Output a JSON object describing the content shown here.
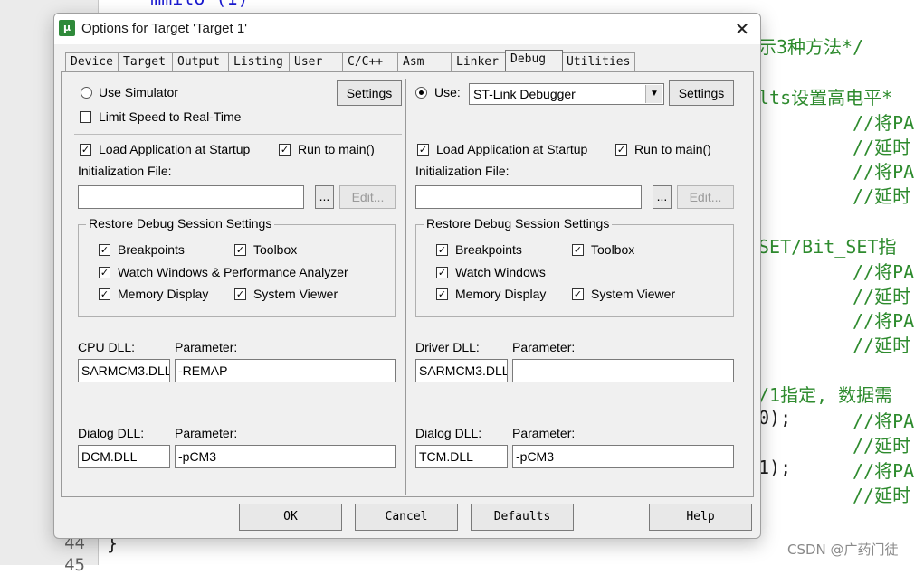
{
  "editor": {
    "line_numbers": [
      "44",
      "45"
    ],
    "top_line": "    mmilo (1)",
    "close_brace": "}",
    "comments": [
      "示3种方法*/",
      "lts设置高电平*",
      "//将PA",
      "//延时",
      "//将PA",
      "//延时",
      "SET/Bit_SET指",
      "//将PA",
      "//延时",
      "//将PA",
      "//延时",
      "/1指定, 数据需",
      "0);",
      "//将PA",
      "//延时",
      "1);",
      "//将PA",
      "//延时"
    ],
    "watermark": "CSDN @广药门徒"
  },
  "dialog": {
    "title": "Options for Target 'Target 1'",
    "close_glyph": "✕",
    "app_icon_glyph": "μ",
    "tabs": [
      "Device",
      "Target",
      "Output",
      "Listing",
      "User",
      "C/C++",
      "Asm",
      "Linker",
      "Debug",
      "Utilities"
    ],
    "active_tab": "Debug",
    "left": {
      "use_simulator": "Use Simulator",
      "settings": "Settings",
      "limit_speed": "Limit Speed to Real-Time",
      "load_app": "Load Application at Startup",
      "run_to_main": "Run to main()",
      "init_file": "Initialization File:",
      "browse": "...",
      "edit": "Edit...",
      "restore_title": "Restore Debug Session Settings",
      "breakpoints": "Breakpoints",
      "toolbox": "Toolbox",
      "watch": "Watch Windows & Performance Analyzer",
      "memory": "Memory Display",
      "system_viewer": "System Viewer",
      "cpu_dll_label": "CPU DLL:",
      "parameter_label": "Parameter:",
      "cpu_dll_value": "SARMCM3.DLL",
      "cpu_param_value": "-REMAP",
      "dialog_dll_label": "Dialog DLL:",
      "dialog_param_label": "Parameter:",
      "dialog_dll_value": "DCM.DLL",
      "dialog_param_value": "-pCM3"
    },
    "right": {
      "use": "Use:",
      "debugger": "ST-Link Debugger",
      "settings": "Settings",
      "load_app": "Load Application at Startup",
      "run_to_main": "Run to main()",
      "init_file": "Initialization File:",
      "browse": "...",
      "edit": "Edit...",
      "restore_title": "Restore Debug Session Settings",
      "breakpoints": "Breakpoints",
      "toolbox": "Toolbox",
      "watch": "Watch Windows",
      "memory": "Memory Display",
      "system_viewer": "System Viewer",
      "driver_dll_label": "Driver DLL:",
      "parameter_label": "Parameter:",
      "driver_dll_value": "SARMCM3.DLL",
      "driver_param_value": "",
      "dialog_dll_label": "Dialog DLL:",
      "dialog_param_label": "Parameter:",
      "dialog_dll_value": "TCM.DLL",
      "dialog_param_value": "-pCM3"
    },
    "buttons": {
      "ok": "OK",
      "cancel": "Cancel",
      "defaults": "Defaults",
      "help": "Help"
    },
    "check_glyph": "✓"
  }
}
